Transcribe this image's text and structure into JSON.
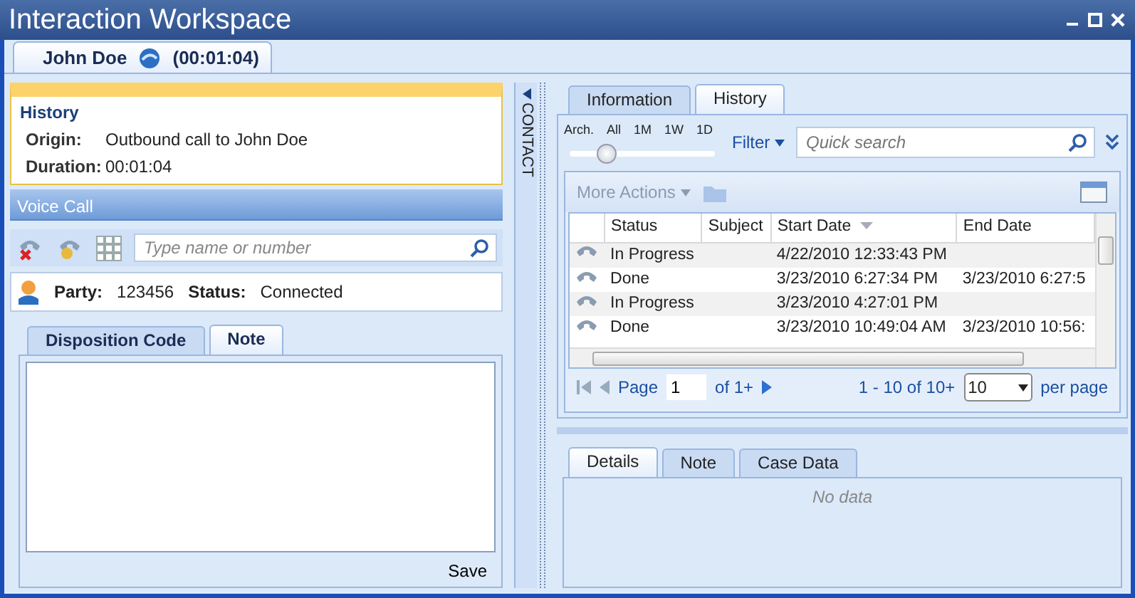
{
  "window": {
    "title": "Interaction Workspace"
  },
  "interaction_tab": {
    "name": "John Doe",
    "timer": "(00:01:04)",
    "selected": true
  },
  "history_card": {
    "heading": "History",
    "fields": [
      {
        "label": "Origin:",
        "value": "Outbound call to John Doe"
      },
      {
        "label": "Duration:",
        "value": "00:01:04"
      }
    ]
  },
  "voice_call": {
    "title": "Voice Call",
    "search_placeholder": "Type name or number",
    "party_label": "Party:",
    "party": "123456",
    "status_label": "Status:",
    "status": "Connected"
  },
  "left_tabs": [
    {
      "label": "Disposition Code",
      "selected": false
    },
    {
      "label": "Note",
      "selected": true
    }
  ],
  "note": {
    "save": "Save"
  },
  "side_tab": {
    "label": "CONTACT"
  },
  "right_tabs": [
    {
      "label": "Information",
      "selected": false
    },
    {
      "label": "History",
      "selected": true
    }
  ],
  "range_slider": {
    "ticks": [
      "Arch.",
      "All",
      "1M",
      "1W",
      "1D"
    ],
    "level": 0.25
  },
  "filter": "Filter",
  "quick_search_placeholder": "Quick search",
  "more_actions": {
    "label": "More Actions",
    "disabled": true
  },
  "table": {
    "columns": [
      "Status",
      "Subject",
      "Start Date",
      "End Date"
    ],
    "rows": [
      {
        "status": "In Progress",
        "start_date": "4/22/2010 12:33:43 PM"
      },
      {
        "status": "Done",
        "start_date": "3/23/2010 6:27:34 PM",
        "end_date": "3/23/2010 6:27:5"
      },
      {
        "status": "In Progress",
        "start_date": "3/23/2010 4:27:01 PM"
      },
      {
        "status": "Done",
        "start_date": "3/23/2010 10:49:04 AM",
        "end_date": "3/23/2010 10:56:"
      }
    ]
  },
  "pager": {
    "page_label": "Page",
    "page": "1",
    "of": "of 1+",
    "range": "1 - 10 of 10+",
    "per_page_value": "10",
    "per_page": "per page"
  },
  "bottom_tabs": [
    {
      "label": "Details",
      "selected": true
    },
    {
      "label": "Note",
      "selected": false
    },
    {
      "label": "Case Data",
      "selected": false
    }
  ],
  "empty_message": "No data"
}
